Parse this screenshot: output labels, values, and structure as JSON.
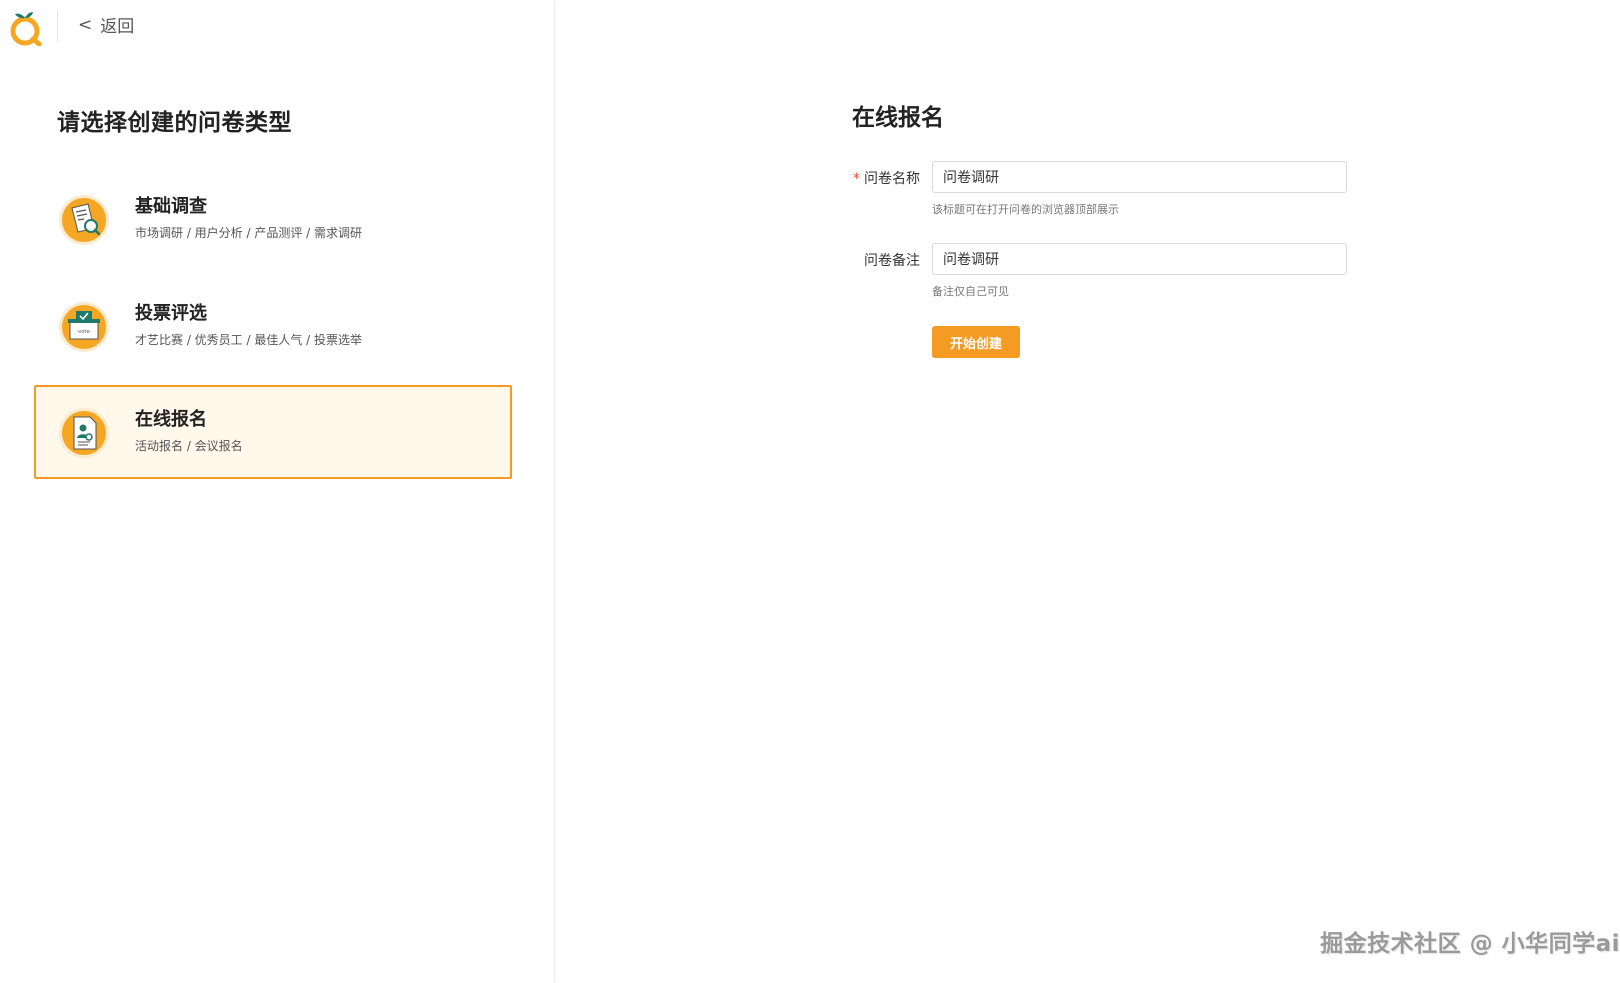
{
  "header": {
    "back_label": "返回",
    "back_icon": "<"
  },
  "left": {
    "title": "请选择创建的问卷类型",
    "types": [
      {
        "title": "基础调查",
        "desc": "市场调研 / 用户分析 / 产品测评 / 需求调研",
        "icon": "survey-search-icon",
        "active": false
      },
      {
        "title": "投票评选",
        "desc": "才艺比赛 / 优秀员工 / 最佳人气 / 投票选举",
        "icon": "vote-box-icon",
        "active": false,
        "icon_text": "-vote-"
      },
      {
        "title": "在线报名",
        "desc": "活动报名 / 会议报名",
        "icon": "registration-form-icon",
        "active": true
      }
    ]
  },
  "form": {
    "title": "在线报名",
    "name_label": "问卷名称",
    "name_required_mark": "*",
    "name_value": "问卷调研",
    "name_hint": "该标题可在打开问卷的浏览器顶部展示",
    "note_label": "问卷备注",
    "note_value": "问卷调研",
    "note_hint": "备注仅自己可见",
    "submit_label": "开始创建"
  },
  "watermark": "掘金技术社区 @ 小华同学ai",
  "colors": {
    "accent": "#f59a23",
    "active_bg": "#fff8eb",
    "icon_teal": "#1e7a6b",
    "required": "#e74c3c"
  }
}
